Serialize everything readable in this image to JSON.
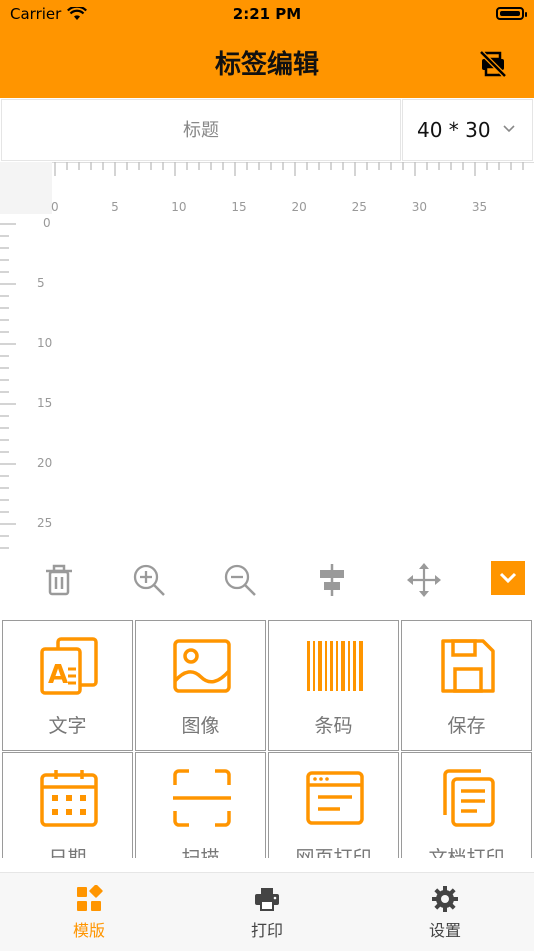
{
  "status": {
    "carrier": "Carrier",
    "time": "2:21 PM"
  },
  "header": {
    "title": "标签编辑"
  },
  "editor": {
    "title_placeholder": "标题",
    "size_value": "40 * 30",
    "ruler_top": [
      "0",
      "5",
      "10",
      "15",
      "20",
      "25",
      "30",
      "35"
    ],
    "ruler_left": [
      "0",
      "5",
      "10",
      "15",
      "20",
      "25"
    ]
  },
  "toolbar": {
    "items": [
      "delete",
      "zoom-in",
      "zoom-out",
      "align-center",
      "move",
      "collapse"
    ]
  },
  "grid": {
    "items": [
      {
        "label": "文字",
        "icon": "text-icon"
      },
      {
        "label": "图像",
        "icon": "image-icon"
      },
      {
        "label": "条码",
        "icon": "barcode-icon"
      },
      {
        "label": "保存",
        "icon": "save-icon"
      },
      {
        "label": "日期",
        "icon": "calendar-icon"
      },
      {
        "label": "扫描",
        "icon": "scan-icon"
      },
      {
        "label": "网页打印",
        "icon": "web-icon"
      },
      {
        "label": "文档打印",
        "icon": "document-icon"
      }
    ]
  },
  "tabbar": {
    "items": [
      {
        "label": "模版",
        "active": true
      },
      {
        "label": "打印",
        "active": false
      },
      {
        "label": "设置",
        "active": false
      }
    ]
  },
  "colors": {
    "accent": "#FF9500",
    "icon_gray": "#9a9a9a",
    "tab_gray": "#444444"
  }
}
